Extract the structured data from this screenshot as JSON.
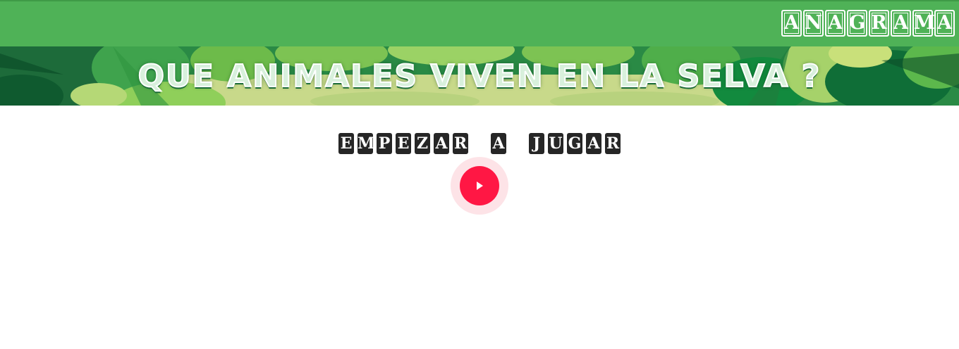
{
  "header": {
    "logo_letters": [
      "A",
      "N",
      "A",
      "G",
      "R",
      "A",
      "M",
      "A"
    ],
    "bar_color": "#4fb257"
  },
  "banner": {
    "title": "QUE ANIMALES VIVEN EN LA SELVA ?"
  },
  "start": {
    "label_letters": [
      "E",
      "M",
      "P",
      "E",
      "Z",
      "A",
      "R",
      " ",
      "A",
      " ",
      "J",
      "U",
      "G",
      "A",
      "R"
    ],
    "play_icon": "play-icon",
    "play_color": "#ff1744"
  }
}
